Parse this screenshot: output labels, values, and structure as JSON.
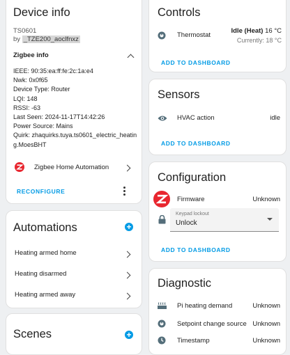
{
  "device_info": {
    "title": "Device info",
    "model": "TS0601",
    "by_prefix": "by",
    "manufacturer": "_TZE200_aoclfnxz",
    "zigbee_info_label": "Zigbee info",
    "details": [
      "IEEE: 90:35:ea:ff:fe:2c:1a:e4",
      "Nwk: 0x0f65",
      "Device Type: Router",
      "LQI: 148",
      "RSSI: -63",
      "Last Seen: 2024-11-17T14:42:26",
      "Power Source: Mains",
      "Quirk: zhaquirks.tuya.ts0601_electric_heatin",
      "g.MoesBHT"
    ],
    "integration_label": "Zigbee Home Automation",
    "reconfigure_label": "RECONFIGURE"
  },
  "automations": {
    "title": "Automations",
    "items": [
      "Heating armed home",
      "Heating disarmed",
      "Heating armed away"
    ]
  },
  "scenes": {
    "title": "Scenes"
  },
  "controls": {
    "title": "Controls",
    "thermostat_label": "Thermostat",
    "state_text": "Idle (Heat)",
    "target_temp": "16 °C",
    "current_text": "Currently: 18 °C",
    "add_label": "ADD TO DASHBOARD"
  },
  "sensors": {
    "title": "Sensors",
    "hvac_label": "HVAC action",
    "hvac_value": "idle",
    "add_label": "ADD TO DASHBOARD"
  },
  "configuration": {
    "title": "Configuration",
    "firmware_label": "Firmware",
    "firmware_value": "Unknown",
    "keypad_label": "Keypad lockout",
    "keypad_value": "Unlock",
    "add_label": "ADD TO DASHBOARD"
  },
  "diagnostic": {
    "title": "Diagnostic",
    "rows": [
      {
        "label": "Pi heating demand",
        "value": "Unknown"
      },
      {
        "label": "Setpoint change source",
        "value": "Unknown"
      },
      {
        "label": "Timestamp",
        "value": "Unknown"
      }
    ]
  },
  "colors": {
    "accent": "#039be5",
    "zigbee_red": "#e8262f",
    "icon_gray": "#546e7a"
  }
}
